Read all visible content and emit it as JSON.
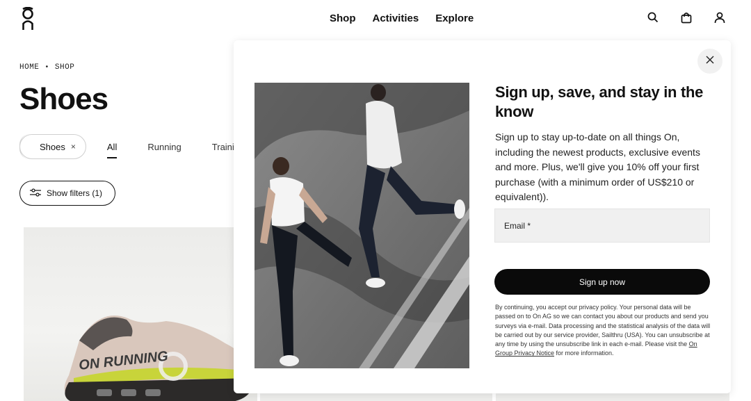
{
  "header": {
    "nav": [
      "Shop",
      "Activities",
      "Explore"
    ],
    "icons": [
      "search-icon",
      "bag-icon",
      "account-icon"
    ]
  },
  "breadcrumb": {
    "home": "HOME",
    "separator": "•",
    "current": "SHOP"
  },
  "page_title": "Shoes",
  "filter_chip": {
    "label": "Shoes",
    "remove": "×"
  },
  "category_tabs": [
    "All",
    "Running",
    "Trainin"
  ],
  "filters_button": "Show filters (1)",
  "product": {
    "shoe_text": "ON RUNNING"
  },
  "modal": {
    "title": "Sign up, save, and stay in the know",
    "description": "Sign up to stay up-to-date on all things On, including the newest products, exclusive events and more. Plus, we'll give you 10% off your first purchase (with a minimum order of US$210 or equivalent)).",
    "email_label": "Email *",
    "submit": "Sign up now",
    "legal_text": "By continuing, you accept our privacy policy. Your personal data will be passed on to On AG so we can contact you about our products and send you surveys via e-mail. Data processing and the statistical analysis of the data will be carried out by our service provider, Sailthru (USA). You can unsubscribe at any time by using the unsubscribe link in each e-mail. Please visit the ",
    "legal_link": "On Group Privacy Notice",
    "legal_suffix": " for more information.",
    "close": "×"
  },
  "colors": {
    "accent": "#0a0a0a",
    "background": "#ffffff",
    "field": "#f0f0f0"
  }
}
